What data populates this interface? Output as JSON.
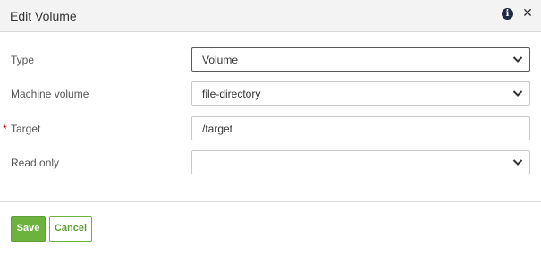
{
  "dialog": {
    "title": "Edit Volume",
    "info_icon": "info-circle-icon",
    "close_icon": "close-icon",
    "close_glyph": "✕",
    "info_glyph": "i"
  },
  "form": {
    "type": {
      "label": "Type",
      "value": "Volume"
    },
    "machine_volume": {
      "label": "Machine volume",
      "value": "file-directory"
    },
    "target": {
      "label": "Target",
      "required_marker": "*",
      "value": "/target"
    },
    "read_only": {
      "label": "Read only",
      "value": ""
    }
  },
  "footer": {
    "save_label": "Save",
    "cancel_label": "Cancel"
  },
  "colors": {
    "accent_green": "#6cb33e",
    "required_red": "#d0021b",
    "header_bg": "#f3f3f3"
  }
}
